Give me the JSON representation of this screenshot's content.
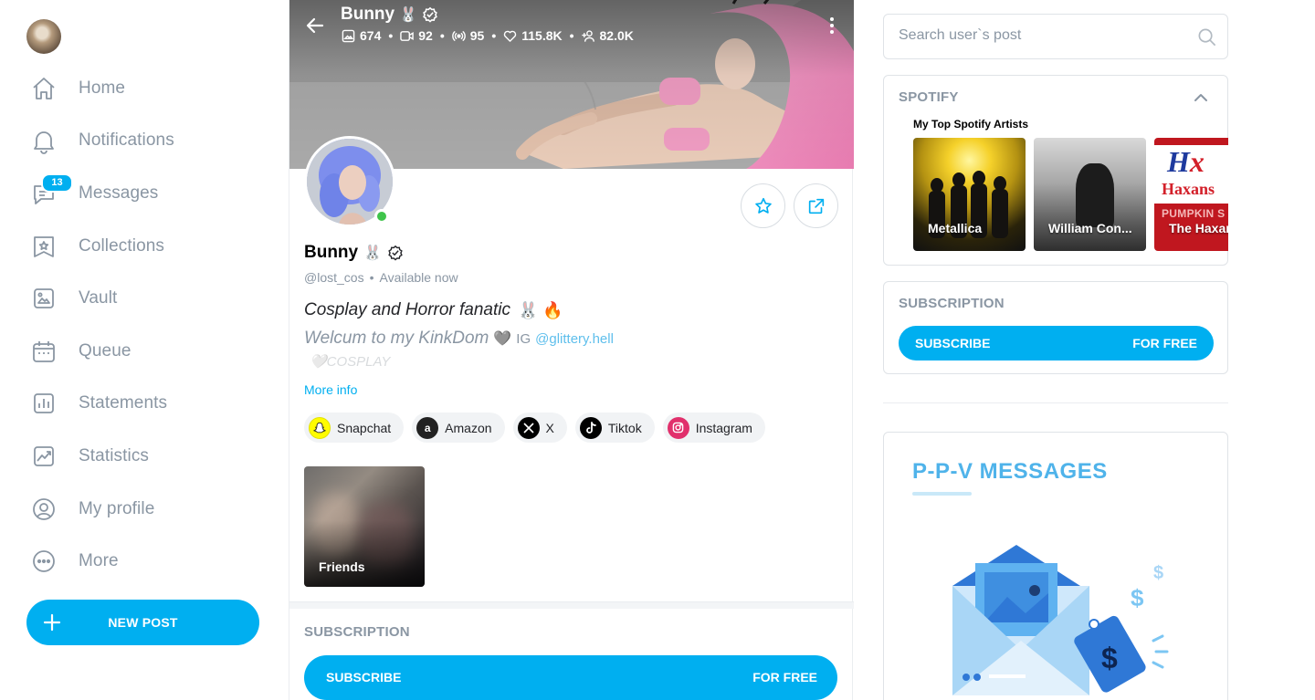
{
  "sidebar": {
    "nav": [
      {
        "label": "Home",
        "icon": "home-icon"
      },
      {
        "label": "Notifications",
        "icon": "bell-icon"
      },
      {
        "label": "Messages",
        "icon": "message-icon",
        "badge": "13"
      },
      {
        "label": "Collections",
        "icon": "collections-icon"
      },
      {
        "label": "Vault",
        "icon": "vault-icon"
      },
      {
        "label": "Queue",
        "icon": "calendar-icon"
      },
      {
        "label": "Statements",
        "icon": "statements-icon"
      },
      {
        "label": "Statistics",
        "icon": "statistics-icon"
      },
      {
        "label": "My profile",
        "icon": "profile-icon"
      },
      {
        "label": "More",
        "icon": "more-icon"
      }
    ],
    "new_post_label": "NEW POST"
  },
  "header": {
    "name": "Bunny",
    "name_emoji": "🐰",
    "stats": {
      "photos": "674",
      "videos": "92",
      "streams": "95",
      "likes": "115.8K",
      "fans": "82.0K"
    }
  },
  "profile": {
    "name": "Bunny",
    "name_emoji": "🐰",
    "handle": "@lost_cos",
    "status": "Available now",
    "bio_line1": "Cosplay and Horror fanatic",
    "bio_line1_emoji": "🐰 🔥",
    "bio_line2": "Welcum to my KinkDom",
    "bio_line2_heart": "🩶",
    "bio_ig_prefix": "IG",
    "bio_ig_link": "@glittery.hell",
    "bio_line3": "🤍COSPLAY",
    "more_info": "More info",
    "links": [
      {
        "label": "Snapchat",
        "icon": "snapchat-icon"
      },
      {
        "label": "Amazon",
        "icon": "amazon-icon"
      },
      {
        "label": "X",
        "icon": "x-icon"
      },
      {
        "label": "Tiktok",
        "icon": "tiktok-icon"
      },
      {
        "label": "Instagram",
        "icon": "instagram-icon"
      }
    ],
    "highlight_label": "Friends"
  },
  "center_subscription": {
    "title": "SUBSCRIPTION",
    "button_left": "SUBSCRIBE",
    "button_right": "FOR FREE"
  },
  "right": {
    "search_placeholder": "Search user`s post",
    "spotify": {
      "title": "SPOTIFY",
      "subtitle": "My Top Spotify Artists",
      "artists": [
        "Metallica",
        "William Con...",
        "The Haxans"
      ],
      "art_text": {
        "logo_h": "H",
        "logo_x": "x",
        "brand": "Haxans",
        "banner": "PUMPKIN S"
      }
    },
    "subscription": {
      "title": "SUBSCRIPTION",
      "button_left": "SUBSCRIBE",
      "button_right": "FOR FREE"
    },
    "ppv": {
      "title": "P-P-V  MESSAGES",
      "art_dollar": "$"
    }
  },
  "colors": {
    "accent": "#00aff0",
    "muted": "#8a96a3",
    "online": "#3fc44b"
  }
}
